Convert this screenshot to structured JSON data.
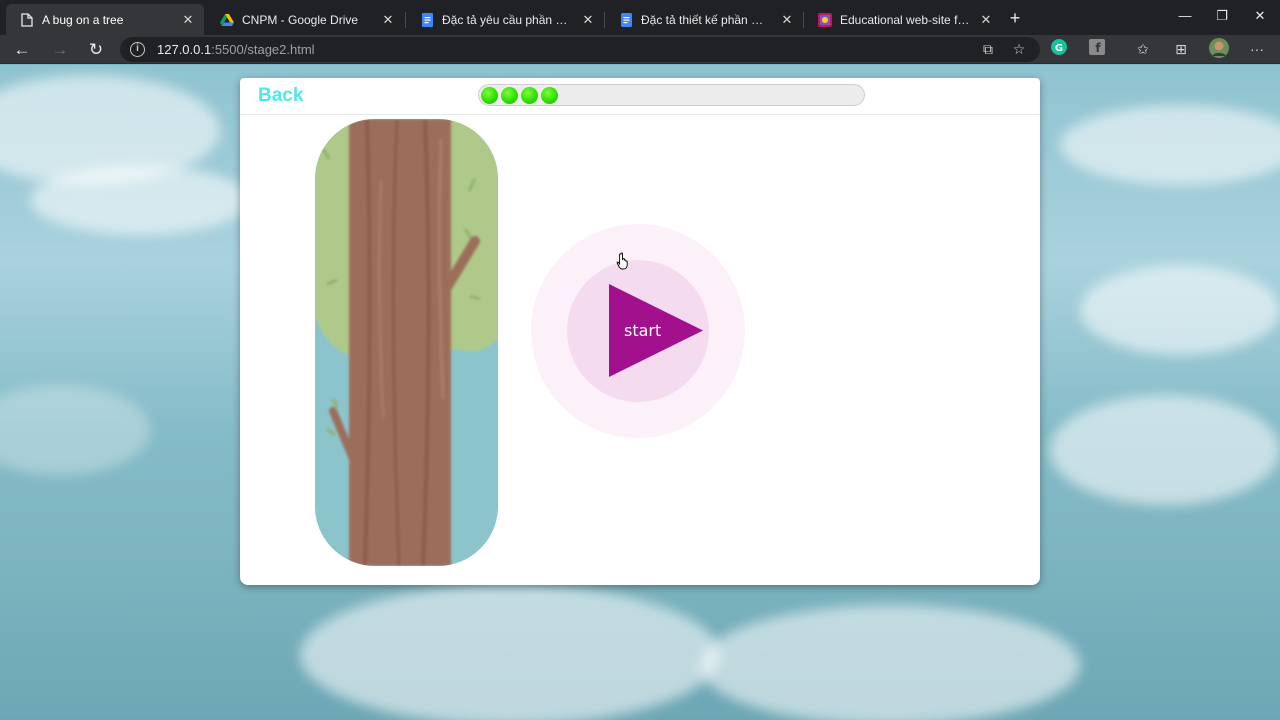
{
  "browser": {
    "tabs": [
      {
        "title": "A bug on a tree",
        "icon": "page-icon",
        "active": true
      },
      {
        "title": "CNPM - Google Drive",
        "icon": "google-drive-icon",
        "active": false
      },
      {
        "title": "Đặc tả yêu cầu phần mềm - Goo",
        "icon": "google-docs-icon",
        "active": false
      },
      {
        "title": "Đặc tả thiết kế phần mềm - Goo",
        "icon": "google-docs-icon",
        "active": false
      },
      {
        "title": "Educational web-site for childre",
        "icon": "site-icon",
        "active": false
      }
    ],
    "new_tab_label": "+",
    "address": {
      "host": "127.0.0.1",
      "path": ":5500/stage2.html"
    },
    "colors": {
      "tabstrip": "#202124",
      "toolbar": "#35363a"
    }
  },
  "game": {
    "back_label": "Back",
    "progress": {
      "filled": 4
    },
    "start_label": "start",
    "colors": {
      "back": "#4de8f0",
      "progress_dot": "#2ee000",
      "start_triangle": "#a3108e",
      "start_ring": "#f4dbf0",
      "foliage": "#afc98a",
      "trunk": "#9c6e5a",
      "sky": "#8cc4cc"
    }
  }
}
